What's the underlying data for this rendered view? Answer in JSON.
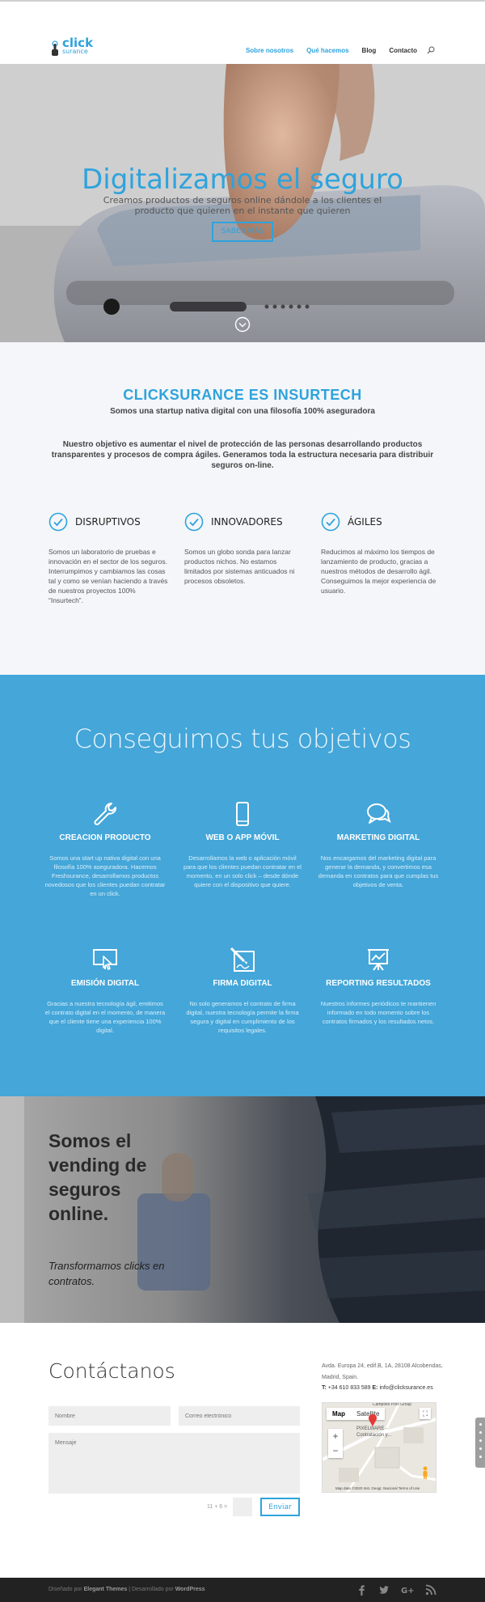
{
  "header": {
    "logo_primary": "click",
    "logo_secondary": "surance",
    "nav": [
      {
        "label": "Sobre nosotros",
        "active": true
      },
      {
        "label": "Qué hacemos",
        "active": true
      },
      {
        "label": "Blog",
        "active": false
      },
      {
        "label": "Contacto",
        "active": false
      }
    ],
    "search_icon": "search-icon"
  },
  "hero": {
    "title": "Digitalizamos el seguro",
    "subtitle": "Creamos productos de seguros online dándole a los clientes el producto que quieren en el instante que quieren",
    "button": "SABER MÁS",
    "scroll_icon": "chevron-down-circle-icon"
  },
  "about": {
    "title": "CLICKSURANCE ES INSURTECH",
    "subtitle": "Somos una startup nativa digital con una filosofía 100% aseguradora",
    "text": "Nuestro objetivo es aumentar el nivel de protección de las personas desarrollando productos transparentes y procesos de compra ágiles. Generamos toda la estructura necesaria para distribuir seguros on-line.",
    "features": [
      {
        "title": "DISRUPTIVOS",
        "text": "Somos un laboratorio de pruebas e innovación en el sector de los seguros. Interrumpimos y cambiamos las cosas tal y como se venían haciendo a través de nuestros proyectos 100% “Insurtech”."
      },
      {
        "title": "INNOVADORES",
        "text": "Somos un globo sonda para lanzar productos nichos. No estamos limitados por sistemas anticuados ni procesos obsoletos."
      },
      {
        "title": "ÁGILES",
        "text": "Reducimos al máximo los tiempos de lanzamiento de producto, gracias a nuestros métodos de desarrollo ágil. Conseguimos la mejor experiencia de usuario."
      }
    ]
  },
  "services": {
    "title": "Conseguimos tus objetivos",
    "items": [
      {
        "icon": "wrench-icon",
        "title": "CREACION PRODUCTO",
        "text": "Somos una start up nativa digital con una filosofía 100% aseguradora. Hacemos Freshsurance, desarrollamos productos novedosos que los clientes puedan contratar en un click."
      },
      {
        "icon": "mobile-phone-icon",
        "title": "WEB O APP MÓVIL",
        "text": "Desarrollamos la web o aplicación móvil para que los clientes puedan contratar en el momento, en un solo click – desde dónde quiere con el dispositivo que quiere."
      },
      {
        "icon": "chat-bubbles-icon",
        "title": "MARKETING DIGITAL",
        "text": "Nos encargamos del marketing digital para generar la demanda, y convertimos esa demanda en contratos para que cumplas tus objetivos de venta."
      },
      {
        "icon": "screen-cursor-icon",
        "title": "EMISIÓN DIGITAL",
        "text": "Gracias a nuestra tecnología ágil, emitimos el contrato digital en el momento, de manera que el cliente tiene una experiencia 100% digital."
      },
      {
        "icon": "signature-pen-icon",
        "title": "FIRMA DIGITAL",
        "text": "No solo generamos el contrato de firma digital, nuestra tecnología permite la firma segura y digital en cumplimiento de los requisitos legales."
      },
      {
        "icon": "presentation-chart-icon",
        "title": "REPORTING RESULTADOS",
        "text": "Nuestros informes periódicos te mantienen informado en todo momento sobre los contratos firmados y los resultados netos."
      }
    ]
  },
  "vending": {
    "title": "Somos el vending de seguros online.",
    "subtitle": "Transformamos clicks en contratos."
  },
  "contact": {
    "title": "Contáctanos",
    "name_placeholder": "Nombre",
    "email_placeholder": "Correo electrónico",
    "message_placeholder": "Mensaje",
    "captcha": "11 + 6 =",
    "send": "Enviar",
    "address": "Avda. Europa 24, edif.B, 1A, 28108 Alcobendas, Madrid, Spain.",
    "phone_label": "T:",
    "phone": "+34 610 833 589",
    "email_label": "E:",
    "email": "info@clicksurance.es",
    "map": {
      "tab_map": "Map",
      "tab_satellite": "Satellite",
      "place_top": "Campolto Pool Group",
      "place": "PIXELWARE - Contratación y...",
      "attribution": "Map data ©2020 Inst. Geogr. Nacional   Terms of Use"
    }
  },
  "footer": {
    "prefix": "Diseñado por",
    "designer": "Elegant Themes",
    "middle": "| Desarrollado por",
    "platform": "WordPress",
    "social": [
      "facebook-icon",
      "twitter-icon",
      "google-plus-icon",
      "rss-icon"
    ]
  },
  "colors": {
    "accent": "#2ea3dc",
    "services_bg": "#44a6d9",
    "about_bg": "#f4f6f9",
    "footer_bg": "#222222"
  }
}
